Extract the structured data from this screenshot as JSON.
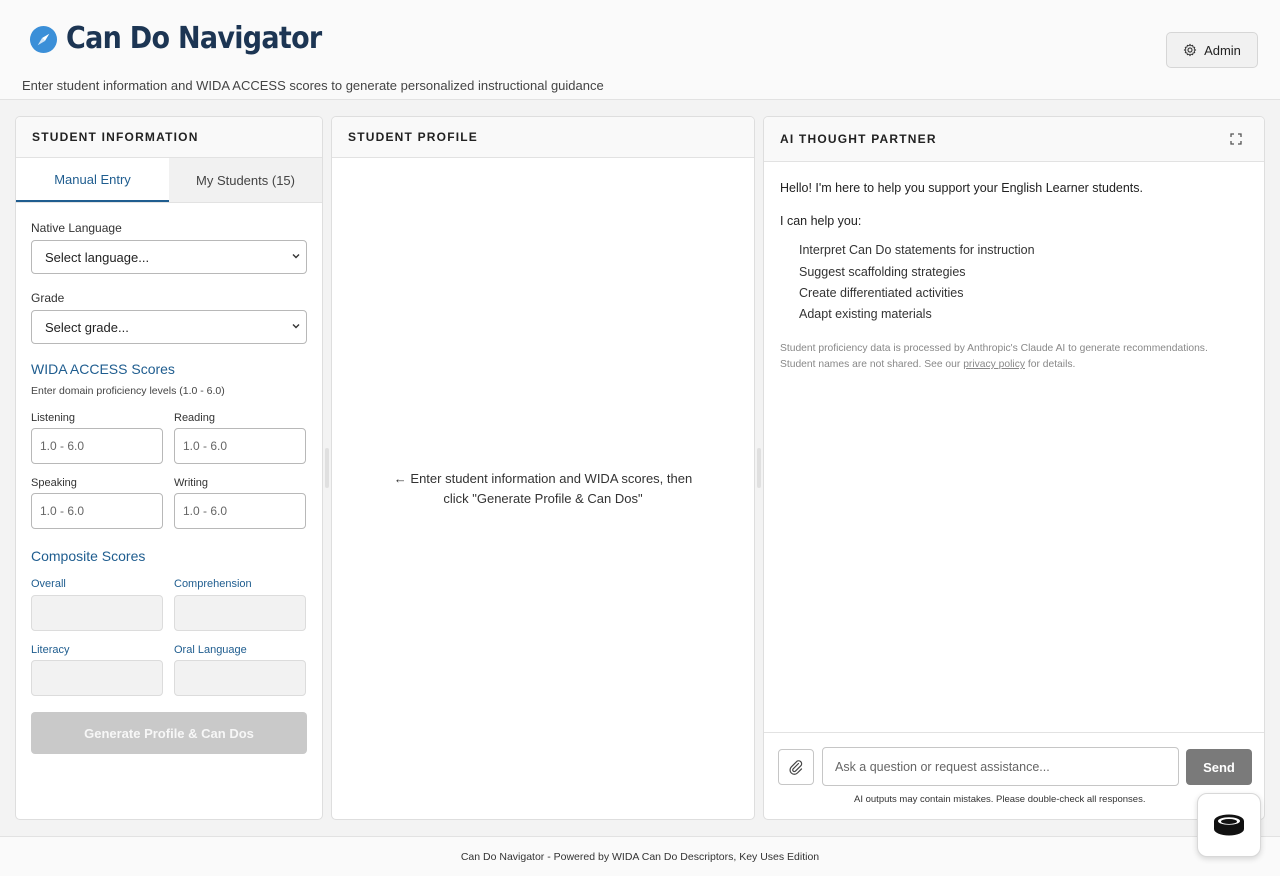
{
  "header": {
    "title": "Can Do Navigator",
    "subtitle": "Enter student information and WIDA ACCESS scores to generate personalized instructional guidance",
    "admin_label": "Admin"
  },
  "left_panel": {
    "title": "STUDENT INFORMATION",
    "tabs": [
      {
        "label": "Manual Entry",
        "active": true
      },
      {
        "label": "My Students (15)",
        "active": false
      }
    ],
    "native_language": {
      "label": "Native Language",
      "value": "Select language..."
    },
    "grade": {
      "label": "Grade",
      "value": "Select grade..."
    },
    "wida": {
      "title": "WIDA ACCESS Scores",
      "hint": "Enter domain proficiency levels (1.0 - 6.0)",
      "fields": [
        {
          "label": "Listening",
          "placeholder": "1.0 - 6.0"
        },
        {
          "label": "Reading",
          "placeholder": "1.0 - 6.0"
        },
        {
          "label": "Speaking",
          "placeholder": "1.0 - 6.0"
        },
        {
          "label": "Writing",
          "placeholder": "1.0 - 6.0"
        }
      ]
    },
    "composite": {
      "title": "Composite Scores",
      "fields": [
        {
          "label": "Overall",
          "value": ""
        },
        {
          "label": "Comprehension",
          "value": ""
        },
        {
          "label": "Literacy",
          "value": ""
        },
        {
          "label": "Oral Language",
          "value": ""
        }
      ]
    },
    "generate_label": "Generate Profile & Can Dos"
  },
  "middle_panel": {
    "title": "STUDENT PROFILE",
    "message_line1": "← Enter student information and WIDA scores, then",
    "message_line2": "click \"Generate Profile & Can Dos\""
  },
  "right_panel": {
    "title": "AI THOUGHT PARTNER",
    "greeting": "Hello! I'm here to help you support your English Learner students.",
    "help_intro": "I can help you:",
    "help_items": [
      "Interpret Can Do statements for instruction",
      "Suggest scaffolding strategies",
      "Create differentiated activities",
      "Adapt existing materials"
    ],
    "disclaimer_part1": "Student proficiency data is processed by Anthropic's Claude AI to generate recommendations. Student names are not shared. See our ",
    "disclaimer_link": "privacy policy",
    "disclaimer_part2": " for details.",
    "input_placeholder": "Ask a question or request assistance...",
    "send_label": "Send",
    "note": "AI outputs may contain mistakes. Please double-check all responses."
  },
  "footer": {
    "text": "Can Do Navigator - Powered by WIDA Can Do Descriptors, Key Uses Edition"
  },
  "colors": {
    "accent": "#1f5d8f",
    "title": "#1c3553",
    "logo": "#3b8fd8",
    "send_button": "#7a7a7a",
    "disabled_button": "#c9c9c9"
  },
  "icons": {
    "logo": "compass-icon",
    "admin": "gear-icon",
    "expand": "expand-icon",
    "attach": "paperclip-icon",
    "chevron": "chevron-down-icon",
    "floating": "stacked-disc-icon"
  }
}
